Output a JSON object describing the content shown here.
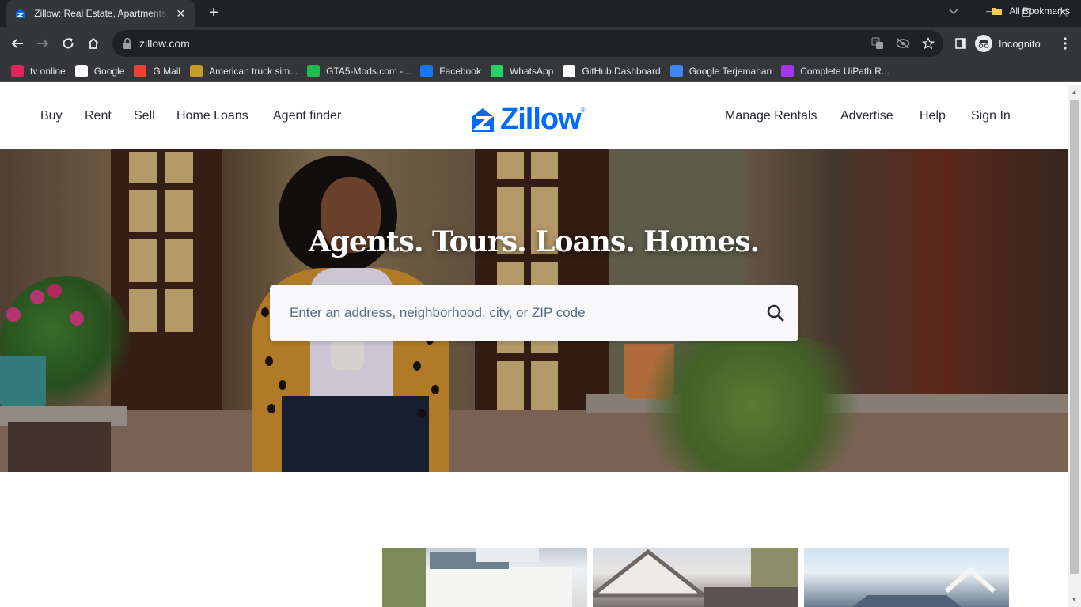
{
  "browser": {
    "tab": {
      "title": "Zillow: Real Estate, Apartments, Mortgages & Home Values",
      "close": "✕"
    },
    "new_tab": "+",
    "address": {
      "url": "zillow.com"
    },
    "profile": {
      "label": "Incognito"
    },
    "bookmarks": [
      {
        "label": "tv online",
        "icon": "vidio-icon",
        "color": "#e0245e"
      },
      {
        "label": "Google",
        "icon": "google-icon",
        "color": "#ffffff"
      },
      {
        "label": "G Mail",
        "icon": "gmail-icon",
        "color": "#ea4335"
      },
      {
        "label": "American truck sim...",
        "icon": "ats-icon",
        "color": "#c89b2a"
      },
      {
        "label": "GTA5-Mods.com -...",
        "icon": "gta5mods-icon",
        "color": "#20ba4e"
      },
      {
        "label": "Facebook",
        "icon": "facebook-icon",
        "color": "#1877f2"
      },
      {
        "label": "WhatsApp",
        "icon": "whatsapp-icon",
        "color": "#25d366"
      },
      {
        "label": "GitHub Dashboard",
        "icon": "github-icon",
        "color": "#ffffff"
      },
      {
        "label": "Google Terjemahan",
        "icon": "translate-icon",
        "color": "#4285f4"
      },
      {
        "label": "Complete UiPath R...",
        "icon": "udemy-icon",
        "color": "#a435f0"
      }
    ],
    "all_bookmarks": "All Bookmarks"
  },
  "site": {
    "nav_left": [
      "Buy",
      "Rent",
      "Sell",
      "Home Loans",
      "Agent finder"
    ],
    "logo": {
      "text": "Zillow",
      "reg": "®"
    },
    "nav_right": [
      "Manage Rentals",
      "Advertise",
      "Help",
      "Sign In"
    ],
    "brand_color": "#006aff"
  },
  "hero": {
    "title": "Agents. Tours. Loans. Homes.",
    "search": {
      "placeholder": "Enter an address, neighborhood, city, or ZIP code",
      "value": ""
    }
  }
}
